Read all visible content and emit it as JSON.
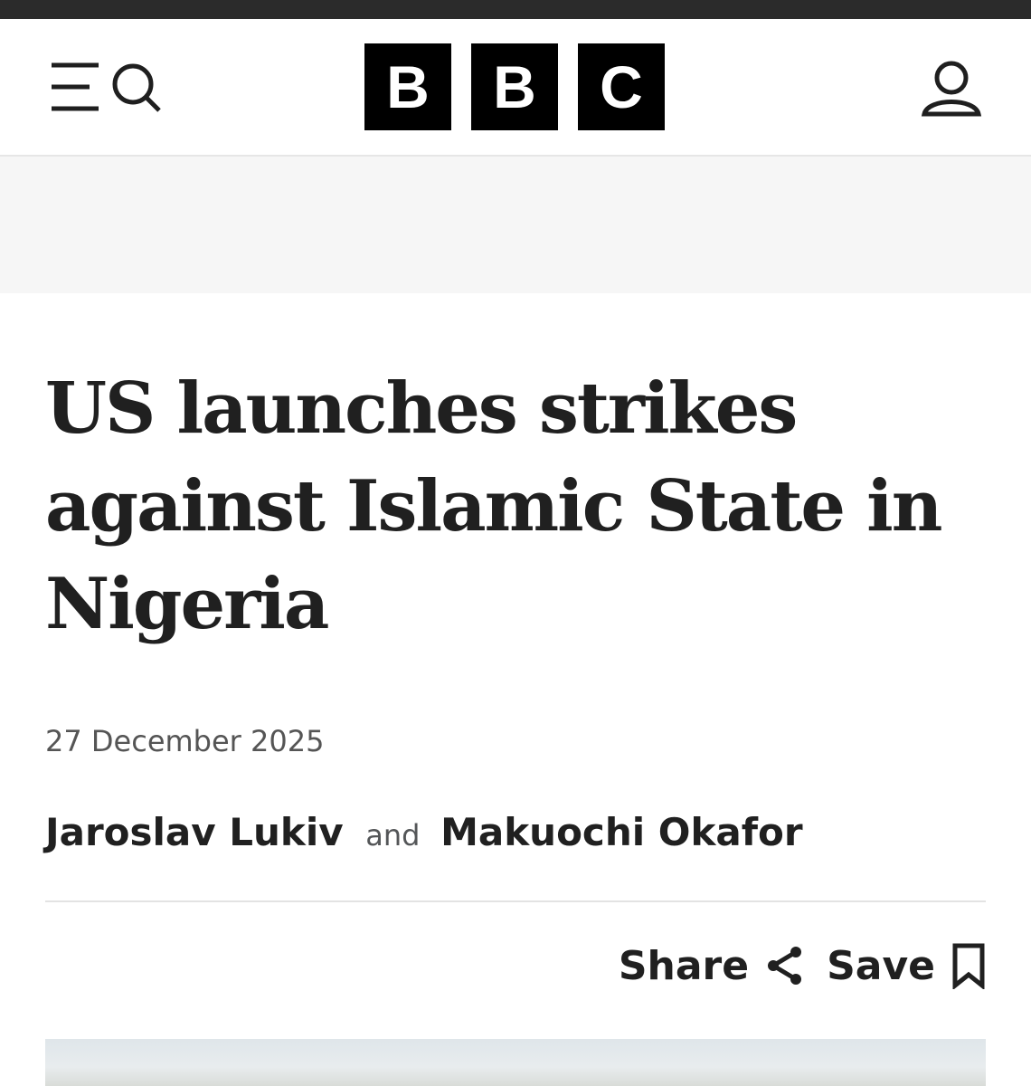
{
  "header": {
    "logo_letters": [
      "B",
      "B",
      "C"
    ],
    "menu_icon": "menu-icon",
    "search_icon": "search-icon",
    "account_icon": "account-icon"
  },
  "article": {
    "headline": "US launches strikes against Islamic State in Nigeria",
    "date": "27 December 2025",
    "authors": [
      "Jaroslav Lukiv",
      "Makuochi Okafor"
    ],
    "author_joiner": "and",
    "share_label": "Share",
    "save_label": "Save"
  },
  "colors": {
    "topbar": "#2b2b2b",
    "ad_background": "#f6f6f6",
    "text": "#202020",
    "muted": "#555555"
  }
}
